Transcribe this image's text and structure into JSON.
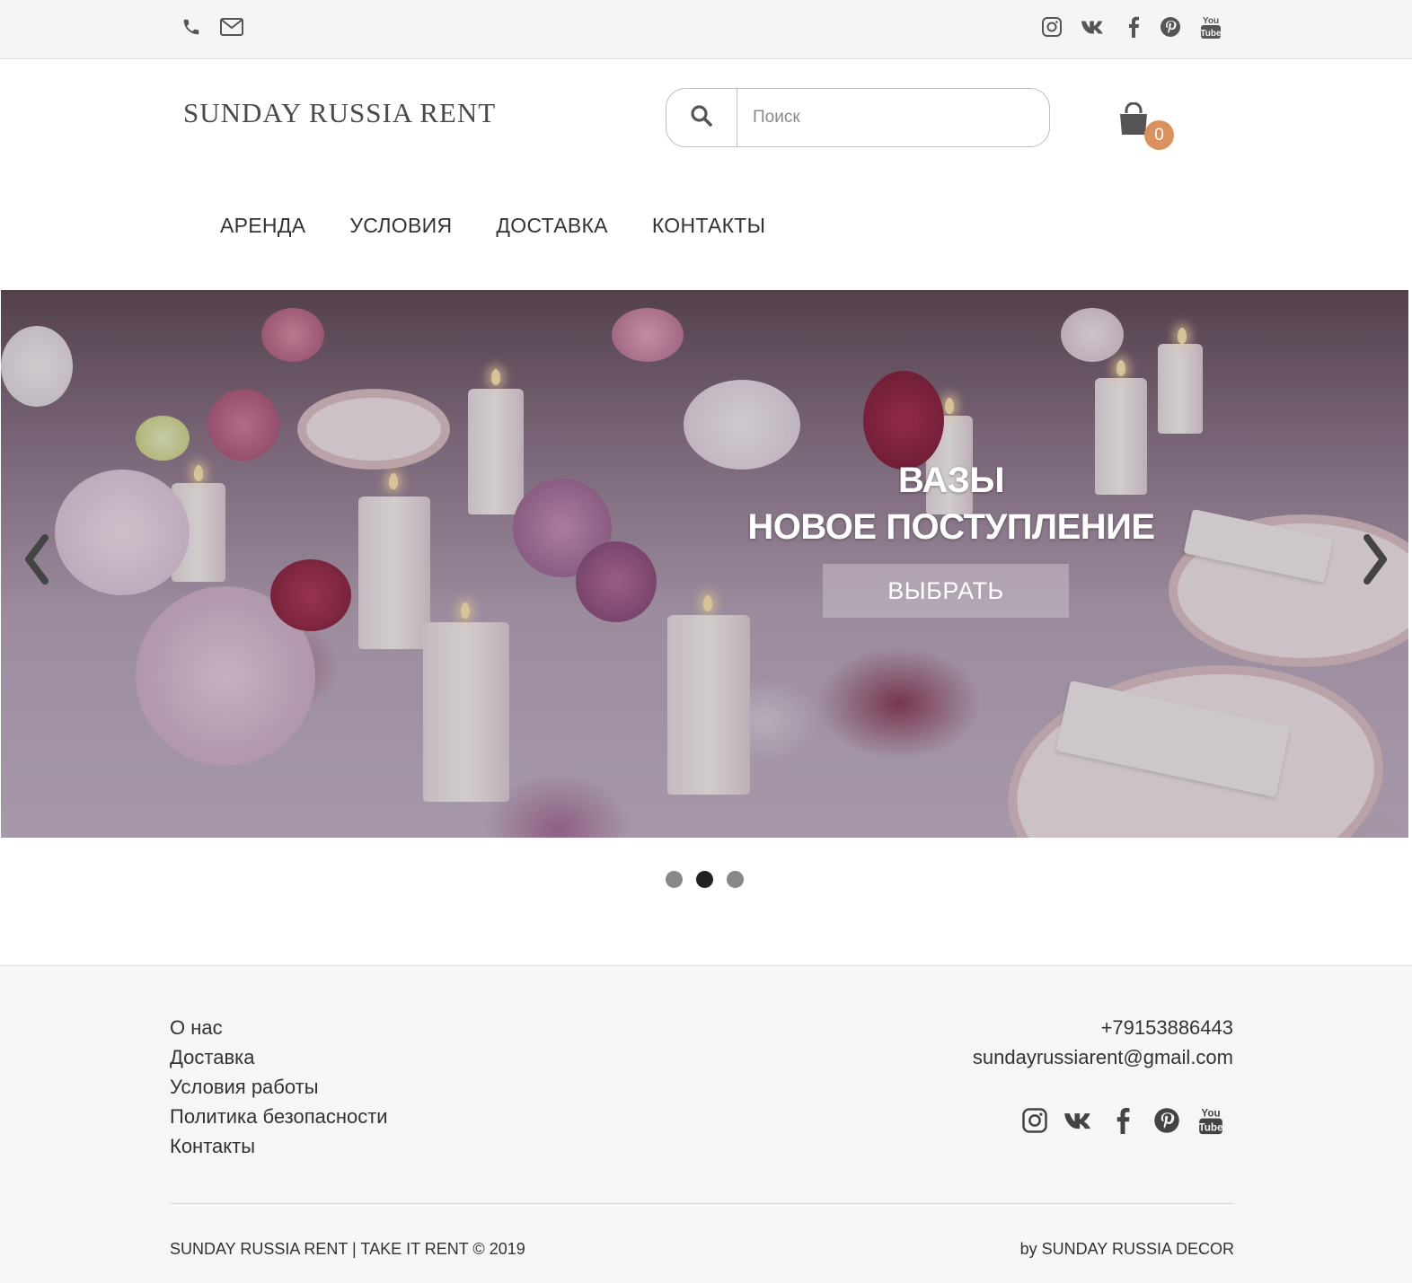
{
  "topbar": {
    "contact_icons": [
      "phone-icon",
      "mail-icon"
    ],
    "social_icons": [
      "instagram-icon",
      "vk-icon",
      "facebook-icon",
      "pinterest-icon",
      "youtube-icon"
    ]
  },
  "header": {
    "logo": "SUNDAY RUSSIA RENT",
    "search_placeholder": "Поиск",
    "search_value": "",
    "cart_count": "0"
  },
  "nav": {
    "items": [
      "АРЕНДА",
      "УСЛОВИЯ",
      "ДОСТАВКА",
      "КОНТАКТЫ"
    ]
  },
  "hero": {
    "title_line1": "ВАЗЫ",
    "title_line2": "НОВОЕ ПОСТУПЛЕНИЕ",
    "button_label": "ВЫБРАТЬ",
    "slide_count": 3,
    "active_slide": 2
  },
  "footer": {
    "links": [
      "О нас",
      "Доставка",
      "Условия работы",
      "Политика безопасности",
      "Контакты"
    ],
    "phone": "+79153886443",
    "email": "sundayrussiarent@gmail.com",
    "copyright": "SUNDAY RUSSIA RENT | TAKE IT RENT © 2019",
    "by": "by SUNDAY RUSSIA DECOR"
  },
  "colors": {
    "accent": "#d9925e",
    "topbar_bg": "#f5f5f5",
    "footer_bg": "#f6f6f6"
  }
}
